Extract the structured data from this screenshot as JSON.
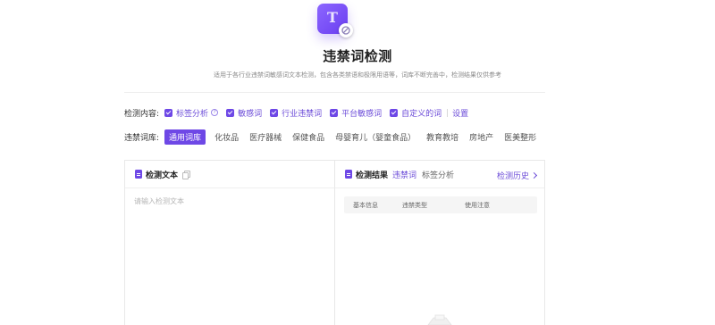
{
  "header": {
    "title": "违禁词检测",
    "subtitle": "适用于各行业违禁词敏感词文本检测，包含各类禁语和极限用语等，词库不断完善中，检测结果仅供参考"
  },
  "detect_content": {
    "label": "检测内容:",
    "options": [
      {
        "label": "标签分析",
        "checked": true,
        "help": "?"
      },
      {
        "label": "敏感词",
        "checked": true
      },
      {
        "label": "行业违禁词",
        "checked": true
      },
      {
        "label": "平台敏感词",
        "checked": true
      },
      {
        "label": "自定义的词",
        "checked": true
      }
    ],
    "settings_label": "设置"
  },
  "lexicon": {
    "label": "违禁词库:",
    "tags": [
      "通用词库",
      "化妆品",
      "医疗器械",
      "保健食品",
      "母婴育儿（婴童食品）",
      "教育教培",
      "房地产",
      "医美整形"
    ],
    "active": "通用词库"
  },
  "input_panel": {
    "title": "检测文本",
    "placeholder": "请输入检测文本"
  },
  "result_panel": {
    "title": "检测结果",
    "tabs": [
      "违禁词",
      "标签分析"
    ],
    "active_tab": "违禁词",
    "history_label": "检测历史",
    "columns": [
      "基本信息",
      "违禁类型",
      "使用注意"
    ]
  },
  "colors": {
    "accent": "#6e48e6",
    "accent_text": "#6b4bd8"
  }
}
